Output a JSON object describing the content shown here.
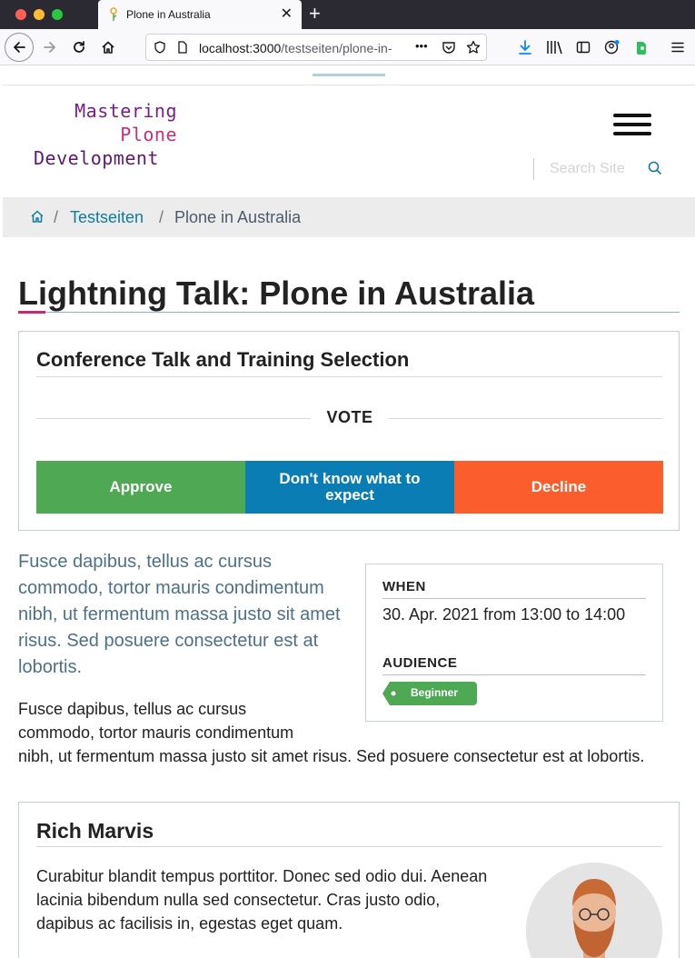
{
  "browser": {
    "tab_title": "Plone in Australia",
    "url_host": "localhost:3000",
    "url_path": "/testseiten/plone-in-",
    "url_more": "•••"
  },
  "site": {
    "logo_line1": "Mastering",
    "logo_line2": "Plone",
    "logo_line3": "Development",
    "search_placeholder": "Search Site"
  },
  "breadcrumbs": {
    "separator": "/",
    "items": [
      {
        "label": "Testseiten"
      },
      {
        "label": "Plone in Australia"
      }
    ]
  },
  "content": {
    "title": "Lightning Talk: Plone in Australia",
    "vote": {
      "heading": "Conference Talk and Training Selection",
      "label": "VOTE",
      "approve": "Approve",
      "unsure": "Don't know what to expect",
      "decline": "Decline"
    },
    "lead": "Fusce dapibus, tellus ac cursus commodo, tortor mauris condimentum nibh, ut fermentum massa justo sit amet risus. Sed posuere consectetur est at lobortis.",
    "details": {
      "when_label": "WHEN",
      "when_value": "30. Apr. 2021 from 13:00 to 14:00",
      "audience_label": "AUDIENCE",
      "audience_tag": "Beginner"
    },
    "body": "Fusce dapibus, tellus ac cursus commodo, tortor mauris condimentum nibh, ut fermentum massa justo sit amet risus. Sed posuere consectetur est at lobortis.",
    "speaker": {
      "name": "Rich Marvis",
      "bio": "Curabitur blandit tempus porttitor. Donec sed odio dui. Aenean lacinia bibendum nulla sed consectetur. Cras justo odio, dapibus ac facilisis in, egestas eget quam."
    }
  },
  "colors": {
    "approve": "#4fa853",
    "unsure": "#0b7db5",
    "decline": "#fb5e2c",
    "link": "#0f7ba1",
    "lead": "#4e7086",
    "accent": "#c72a6e"
  }
}
